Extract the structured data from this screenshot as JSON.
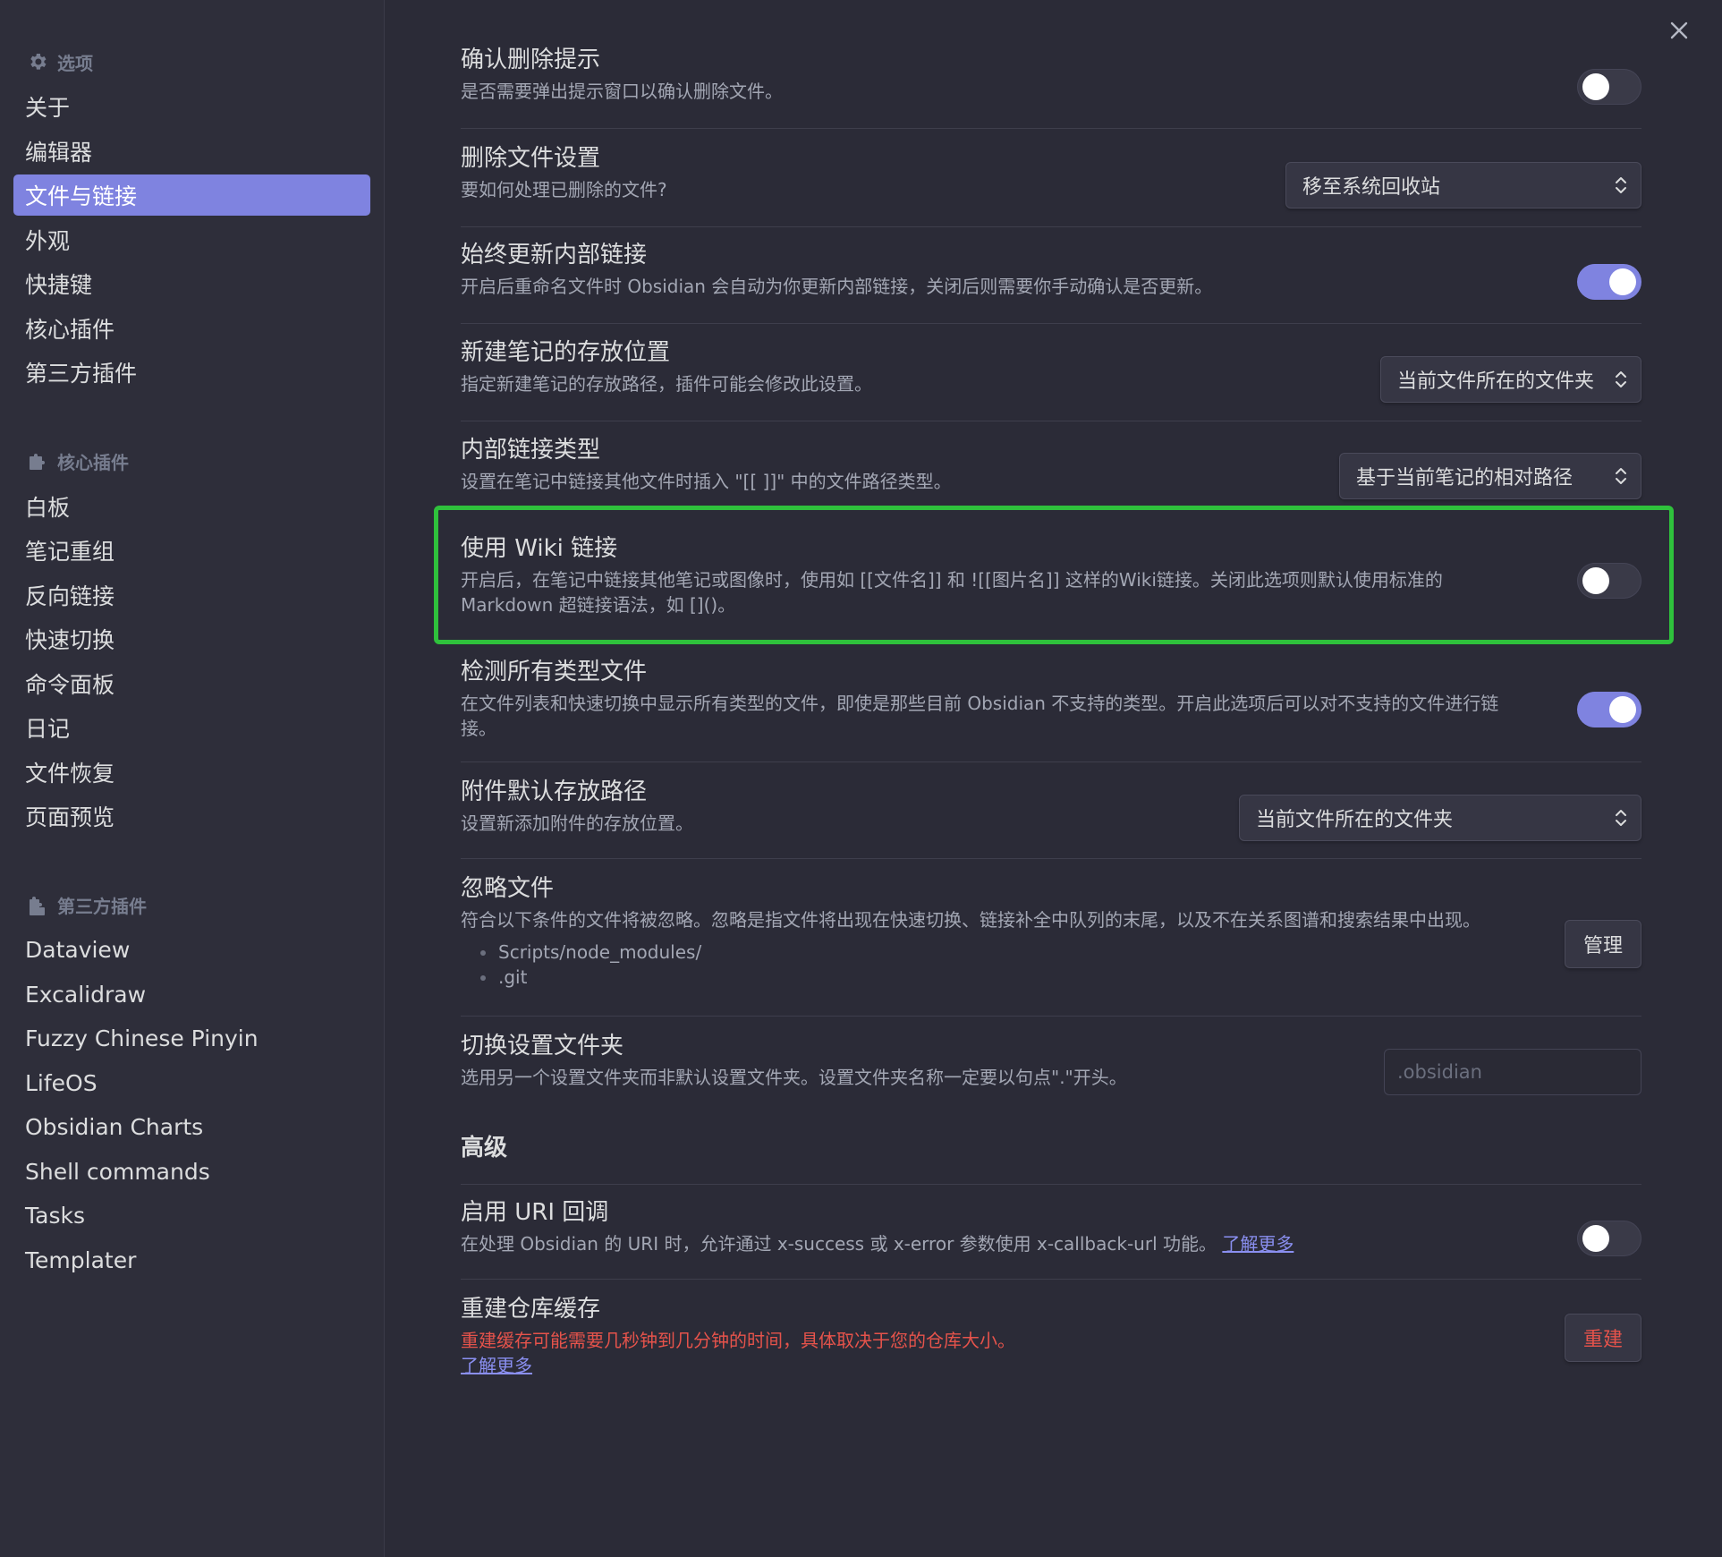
{
  "sidebar": {
    "options_title": "选项",
    "options_items": [
      {
        "label": "关于"
      },
      {
        "label": "编辑器"
      },
      {
        "label": "文件与链接"
      },
      {
        "label": "外观"
      },
      {
        "label": "快捷键"
      },
      {
        "label": "核心插件"
      },
      {
        "label": "第三方插件"
      }
    ],
    "active_item": "文件与链接",
    "core_title": "核心插件",
    "core_items": [
      {
        "label": "白板"
      },
      {
        "label": "笔记重组"
      },
      {
        "label": "反向链接"
      },
      {
        "label": "快速切换"
      },
      {
        "label": "命令面板"
      },
      {
        "label": "日记"
      },
      {
        "label": "文件恢复"
      },
      {
        "label": "页面预览"
      }
    ],
    "community_title": "第三方插件",
    "community_items": [
      {
        "label": "Dataview"
      },
      {
        "label": "Excalidraw"
      },
      {
        "label": "Fuzzy Chinese Pinyin"
      },
      {
        "label": "LifeOS"
      },
      {
        "label": "Obsidian Charts"
      },
      {
        "label": "Shell commands"
      },
      {
        "label": "Tasks"
      },
      {
        "label": "Templater"
      }
    ]
  },
  "settings": {
    "confirm_delete": {
      "name": "确认删除提示",
      "desc": "是否需要弹出提示窗口以确认删除文件。",
      "enabled": false
    },
    "deleted_files": {
      "name": "删除文件设置",
      "desc": "要如何处理已删除的文件?",
      "value": "移至系统回收站"
    },
    "update_links": {
      "name": "始终更新内部链接",
      "desc": "开启后重命名文件时 Obsidian 会自动为你更新内部链接，关闭后则需要你手动确认是否更新。",
      "enabled": true
    },
    "new_note_location": {
      "name": "新建笔记的存放位置",
      "desc": "指定新建笔记的存放路径，插件可能会修改此设置。",
      "value": "当前文件所在的文件夹"
    },
    "link_format": {
      "name": "内部链接类型",
      "desc": "设置在笔记中链接其他文件时插入 \"[[ ]]\" 中的文件路径类型。",
      "value": "基于当前笔记的相对路径"
    },
    "wiki_links": {
      "name": "使用 Wiki 链接",
      "desc_line1": "开启后，在笔记中链接其他笔记或图像时，使用如 [[文件名]] 和 ![[图片名]] 这样的Wiki链接。关闭此选项则默认使用标准的",
      "desc_line2": "Markdown 超链接语法，如 []()。",
      "enabled": false
    },
    "detect_all": {
      "name": "检测所有类型文件",
      "desc_line1": "在文件列表和快速切换中显示所有类型的文件，即使是那些目前 Obsidian 不支持的类型。开启此选项后可以对不支持的文件进行链",
      "desc_line2": "接。",
      "enabled": true
    },
    "attachment_path": {
      "name": "附件默认存放路径",
      "desc": "设置新添加附件的存放位置。",
      "value": "当前文件所在的文件夹"
    },
    "excluded_files": {
      "name": "忽略文件",
      "desc": "符合以下条件的文件将被忽略。忽略是指文件将出现在快速切换、链接补全中队列的末尾，以及不在关系图谱和搜索结果中出现。",
      "items": [
        "Scripts/node_modules/",
        ".git"
      ],
      "button": "管理"
    },
    "config_folder": {
      "name": "切换设置文件夹",
      "desc": "选用另一个设置文件夹而非默认设置文件夹。设置文件夹名称一定要以句点\".\"开头。",
      "placeholder": ".obsidian"
    },
    "advanced_heading": "高级",
    "uri_callback": {
      "name": "启用 URI 回调",
      "desc": "在处理 Obsidian 的 URI 时，允许通过 x-success 或 x-error 参数使用 x-callback-url 功能。",
      "link": "了解更多",
      "enabled": false
    },
    "rebuild_cache": {
      "name": "重建仓库缓存",
      "desc": "重建缓存可能需要几秒钟到几分钟的时间，具体取决于您的仓库大小。",
      "link": "了解更多",
      "button": "重建"
    }
  },
  "colors": {
    "accent": "#7f83e0",
    "highlight_box": "#2fc13c",
    "danger": "#e5534b",
    "background": "#2b2b37"
  }
}
